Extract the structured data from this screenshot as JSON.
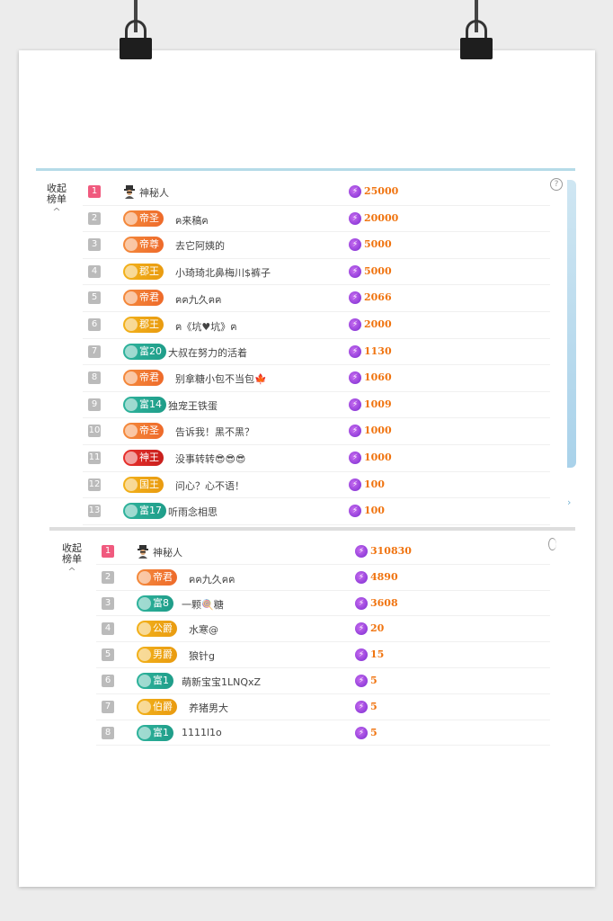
{
  "panel1": {
    "collapse_label": "收起榜单",
    "help_label": "?",
    "rows": [
      {
        "rank": "1",
        "badge": "",
        "badge_color": "",
        "name": "神秘人",
        "score": "25000"
      },
      {
        "rank": "2",
        "badge": "帝圣",
        "badge_color": "orange",
        "name": "ฅ来稿ฅ",
        "score": "20000"
      },
      {
        "rank": "3",
        "badge": "帝尊",
        "badge_color": "orange",
        "name": "去它阿姨的",
        "score": "5000"
      },
      {
        "rank": "4",
        "badge": "郡王",
        "badge_color": "gold",
        "name": "小琦琦北鼻梅川$裤子",
        "score": "5000"
      },
      {
        "rank": "5",
        "badge": "帝君",
        "badge_color": "orange",
        "name": "ฅฅ九久ฅฅ",
        "score": "2066"
      },
      {
        "rank": "6",
        "badge": "郡王",
        "badge_color": "gold",
        "name": "ฅ《坑♥坑》ฅ",
        "score": "2000"
      },
      {
        "rank": "7",
        "badge": "富20",
        "badge_color": "green",
        "name": "大叔在努力的活着",
        "score": "1130"
      },
      {
        "rank": "8",
        "badge": "帝君",
        "badge_color": "orange",
        "name": "别拿糖小包不当包🍁",
        "score": "1060"
      },
      {
        "rank": "9",
        "badge": "富14",
        "badge_color": "green",
        "name": "独宠王铁蛋",
        "score": "1009"
      },
      {
        "rank": "10",
        "badge": "帝圣",
        "badge_color": "orange",
        "name": "告诉我！黑不黑？",
        "score": "1000"
      },
      {
        "rank": "11",
        "badge": "神王",
        "badge_color": "red",
        "name": "没事转转😎😎😎",
        "score": "1000"
      },
      {
        "rank": "12",
        "badge": "国王",
        "badge_color": "gold",
        "name": "问心？心不语！",
        "score": "100"
      },
      {
        "rank": "13",
        "badge": "富17",
        "badge_color": "green",
        "name": "听雨念相思",
        "score": "100"
      }
    ]
  },
  "panel2": {
    "collapse_label": "收起榜单",
    "rows": [
      {
        "rank": "1",
        "badge": "",
        "badge_color": "",
        "name": "神秘人",
        "score": "310830"
      },
      {
        "rank": "2",
        "badge": "帝君",
        "badge_color": "orange",
        "name": "ฅฅ九久ฅฅ",
        "score": "4890"
      },
      {
        "rank": "3",
        "badge": "富8",
        "badge_color": "green",
        "name": "一颗🍭糖",
        "score": "3608"
      },
      {
        "rank": "4",
        "badge": "公爵",
        "badge_color": "gold",
        "name": "水寒@",
        "score": "20"
      },
      {
        "rank": "5",
        "badge": "男爵",
        "badge_color": "gold",
        "name": "狼针g",
        "score": "15"
      },
      {
        "rank": "6",
        "badge": "富1",
        "badge_color": "green",
        "name": "萌新宝宝1LNQxZ",
        "score": "5"
      },
      {
        "rank": "7",
        "badge": "伯爵",
        "badge_color": "gold",
        "name": "养猪男大",
        "score": "5"
      },
      {
        "rank": "8",
        "badge": "富1",
        "badge_color": "green",
        "name": "1111l1o",
        "score": "5"
      }
    ]
  },
  "nav_right_label": "›"
}
